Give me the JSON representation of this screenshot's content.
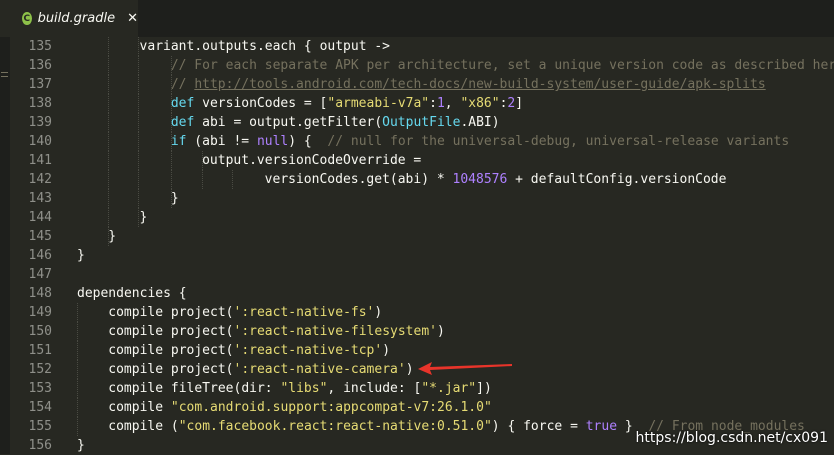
{
  "tab": {
    "title": "build.gradle",
    "close": "✕",
    "icon": "gradle-file-icon"
  },
  "watermark": "https://blog.csdn.net/cx091",
  "code_lines": [
    {
      "num": "135",
      "tokens": [
        [
          "p",
          "variant.outputs.each { "
        ],
        [
          "v",
          "output"
        ],
        [
          "p",
          " ->"
        ]
      ]
    },
    {
      "num": "136",
      "tokens": [
        [
          "c",
          "// For each separate APK per architecture, set a unique version code as described here"
        ]
      ]
    },
    {
      "num": "137",
      "tokens": [
        [
          "c",
          "// "
        ],
        [
          "cu",
          "http://tools.android.com/tech-docs/new-build-system/user-guide/apk-splits"
        ]
      ]
    },
    {
      "num": "138",
      "tokens": [
        [
          "k",
          "def"
        ],
        [
          "p",
          " versionCodes = ["
        ],
        [
          "s",
          "\"armeabi-v7a\""
        ],
        [
          "p",
          ":"
        ],
        [
          "n",
          "1"
        ],
        [
          "p",
          ", "
        ],
        [
          "s",
          "\"x86\""
        ],
        [
          "p",
          ":"
        ],
        [
          "n",
          "2"
        ],
        [
          "p",
          "]"
        ]
      ]
    },
    {
      "num": "139",
      "tokens": [
        [
          "k",
          "def"
        ],
        [
          "p",
          " abi = output.getFilter("
        ],
        [
          "t",
          "OutputFile"
        ],
        [
          "p",
          ".ABI)"
        ]
      ]
    },
    {
      "num": "140",
      "tokens": [
        [
          "k",
          "if"
        ],
        [
          "p",
          " (abi != "
        ],
        [
          "n",
          "null"
        ],
        [
          "p",
          ") {  "
        ],
        [
          "c",
          "// null for the universal-debug, universal-release variants"
        ]
      ]
    },
    {
      "num": "141",
      "tokens": [
        [
          "p",
          "output.versionCodeOverride ="
        ]
      ]
    },
    {
      "num": "142",
      "tokens": [
        [
          "p",
          "versionCodes.get(abi) * "
        ],
        [
          "n",
          "1048576"
        ],
        [
          "p",
          " + defaultConfig.versionCode"
        ]
      ]
    },
    {
      "num": "143",
      "tokens": [
        [
          "p",
          "}"
        ]
      ]
    },
    {
      "num": "144",
      "tokens": [
        [
          "p",
          "}"
        ]
      ]
    },
    {
      "num": "145",
      "tokens": [
        [
          "p",
          "}"
        ]
      ]
    },
    {
      "num": "146",
      "tokens": [
        [
          "p",
          "}"
        ]
      ]
    },
    {
      "num": "147",
      "tokens": []
    },
    {
      "num": "148",
      "tokens": [
        [
          "p",
          "dependencies {"
        ]
      ]
    },
    {
      "num": "149",
      "tokens": [
        [
          "p",
          "compile project("
        ],
        [
          "s",
          "':react-native-fs'"
        ],
        [
          "p",
          ")"
        ]
      ]
    },
    {
      "num": "150",
      "tokens": [
        [
          "p",
          "compile project("
        ],
        [
          "s",
          "':react-native-filesystem'"
        ],
        [
          "p",
          ")"
        ]
      ]
    },
    {
      "num": "151",
      "tokens": [
        [
          "p",
          "compile project("
        ],
        [
          "s",
          "':react-native-tcp'"
        ],
        [
          "p",
          ")"
        ]
      ]
    },
    {
      "num": "152",
      "tokens": [
        [
          "p",
          "compile project("
        ],
        [
          "s",
          "':react-native-camera'"
        ],
        [
          "p",
          ")"
        ]
      ]
    },
    {
      "num": "153",
      "tokens": [
        [
          "p",
          "compile fileTree(dir: "
        ],
        [
          "s",
          "\"libs\""
        ],
        [
          "p",
          ", include: ["
        ],
        [
          "s",
          "\"*.jar\""
        ],
        [
          "p",
          "])"
        ]
      ]
    },
    {
      "num": "154",
      "tokens": [
        [
          "p",
          "compile "
        ],
        [
          "s",
          "\"com.android.support:appcompat-v7:26.1.0\""
        ]
      ]
    },
    {
      "num": "155",
      "tokens": [
        [
          "p",
          "compile ("
        ],
        [
          "s",
          "\"com.facebook.react:react-native:0.51.0\""
        ],
        [
          "p",
          ") { force = "
        ],
        [
          "n",
          "true"
        ],
        [
          "p",
          " }  "
        ],
        [
          "c",
          "// From node_modules"
        ]
      ]
    },
    {
      "num": "156",
      "tokens": [
        [
          "p",
          "}"
        ]
      ]
    }
  ]
}
